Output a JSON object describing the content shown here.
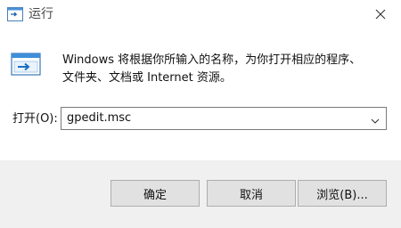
{
  "window": {
    "title": "运行",
    "title_icon": "run-icon",
    "close_icon": "close-icon"
  },
  "main": {
    "app_icon": "run-dialog-icon",
    "description_line1": "Windows 将根据你所输入的名称，为你打开相应的程序、",
    "description_line2": "文件夹、文档或 Internet 资源。",
    "open_label": "打开(O):",
    "open_value": "gpedit.msc",
    "dropdown_icon": "chevron-down-icon"
  },
  "buttons": {
    "ok_label": "确定",
    "cancel_label": "取消",
    "browse_label": "浏览(B)..."
  },
  "colors": {
    "accent": "#1a7fd4",
    "button_bar": "#f0f0f0",
    "button_face": "#e1e1e1",
    "button_border": "#adadad"
  }
}
